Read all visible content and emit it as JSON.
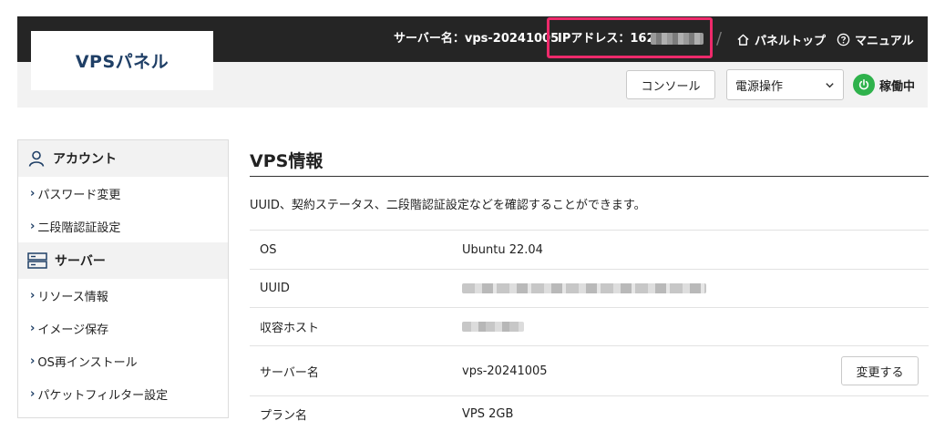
{
  "header": {
    "logo_text": "VPSパネル",
    "server_name": "サーバー名：vps-20241005",
    "ip_label": "IPアドレス：162",
    "separator": "/",
    "panel_top_label": "パネルトップ",
    "manual_label": "マニュアル"
  },
  "controls": {
    "console_label": "コンソール",
    "power_select_value": "電源操作",
    "status_label": "稼働中",
    "status_color": "#2fb24c"
  },
  "sidebar": {
    "sections": [
      {
        "title": "アカウント",
        "icon": "user-icon",
        "items": [
          {
            "label": "パスワード変更"
          },
          {
            "label": "二段階認証設定"
          }
        ]
      },
      {
        "title": "サーバー",
        "icon": "server-icon",
        "items": [
          {
            "label": "リソース情報"
          },
          {
            "label": "イメージ保存"
          },
          {
            "label": "OS再インストール"
          },
          {
            "label": "パケットフィルター設定"
          }
        ]
      }
    ]
  },
  "main": {
    "title": "VPS情報",
    "description": "UUID、契約ステータス、二段階認証設定などを確認することができます。",
    "rows": [
      {
        "key": "OS",
        "value": "Ubuntu 22.04"
      },
      {
        "key": "UUID",
        "value": ""
      },
      {
        "key": "収容ホスト",
        "value": ""
      },
      {
        "key": "サーバー名",
        "value": "vps-20241005",
        "button": "変更する"
      },
      {
        "key": "プラン名",
        "value": "VPS 2GB"
      }
    ]
  },
  "colors": {
    "header_bg": "#252525",
    "highlight": "#ee2a6b",
    "accent_blue": "#1f3f66"
  }
}
